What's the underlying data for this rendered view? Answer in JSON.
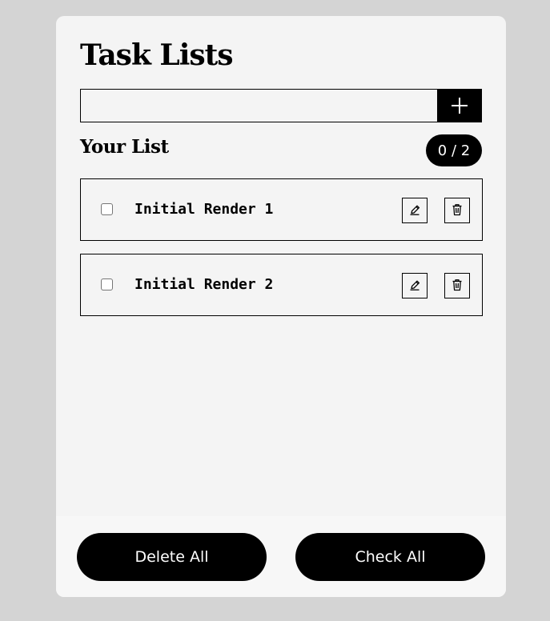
{
  "header": {
    "title": "Task Lists"
  },
  "add_task": {
    "input_value": "",
    "input_placeholder": "",
    "button_icon": "plus-icon"
  },
  "list": {
    "heading": "Your List",
    "count": "0 / 2",
    "tasks": [
      {
        "label": "Initial Render 1",
        "checked": false,
        "edit_icon": "pencil-icon",
        "delete_icon": "trash-icon"
      },
      {
        "label": "Initial Render 2",
        "checked": false,
        "edit_icon": "pencil-icon",
        "delete_icon": "trash-icon"
      }
    ]
  },
  "footer": {
    "delete_all_label": "Delete All",
    "check_all_label": "Check All"
  },
  "colors": {
    "background": "#d4d4d4",
    "card": "#f4f4f4",
    "accent": "#000000",
    "accent_text": "#ffffff"
  }
}
